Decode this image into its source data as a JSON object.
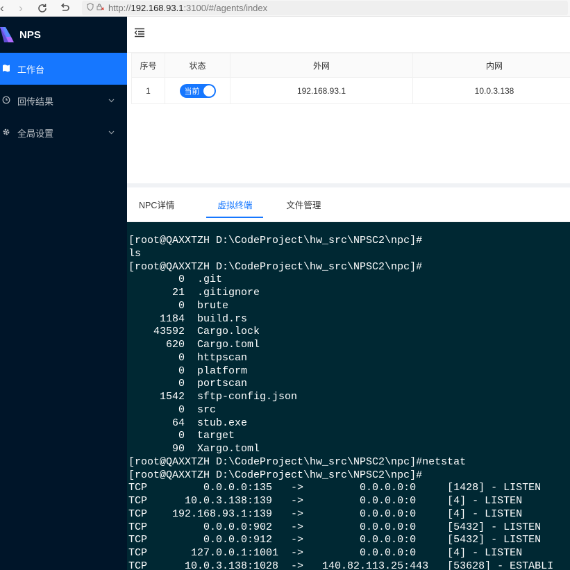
{
  "browser": {
    "url_prefix": "http://",
    "url_host": "192.168.93.1",
    "url_rest": ":3100/#/agents/index"
  },
  "sidebar": {
    "logo_text": "NPS",
    "items": [
      {
        "label": "工作台"
      },
      {
        "label": "回传结果"
      },
      {
        "label": "全局设置"
      }
    ]
  },
  "table": {
    "headers": [
      "序号",
      "状态",
      "外网",
      "内网"
    ],
    "rows": [
      {
        "index": "1",
        "status_label": "当前",
        "status_on": true,
        "external": "192.168.93.1",
        "internal": "10.0.3.138"
      }
    ]
  },
  "tabs": [
    {
      "label": "NPC详情",
      "active": false
    },
    {
      "label": "虚拟终端",
      "active": true
    },
    {
      "label": "文件管理",
      "active": false
    }
  ],
  "terminal": {
    "lines": [
      "[root@QAXXTZH D:\\CodeProject\\hw_src\\NPSC2\\npc]#",
      "ls",
      "[root@QAXXTZH D:\\CodeProject\\hw_src\\NPSC2\\npc]#",
      "        0  .git",
      "       21  .gitignore",
      "        0  brute",
      "     1184  build.rs",
      "    43592  Cargo.lock",
      "      620  Cargo.toml",
      "        0  httpscan",
      "        0  platform",
      "        0  portscan",
      "     1542  sftp-config.json",
      "        0  src",
      "       64  stub.exe",
      "        0  target",
      "       90  Xargo.toml",
      "[root@QAXXTZH D:\\CodeProject\\hw_src\\NPSC2\\npc]#netstat",
      "[root@QAXXTZH D:\\CodeProject\\hw_src\\NPSC2\\npc]#",
      "TCP         0.0.0.0:135   ->         0.0.0.0:0     [1428] - LISTEN",
      "TCP      10.0.3.138:139   ->         0.0.0.0:0     [4] - LISTEN",
      "TCP    192.168.93.1:139   ->         0.0.0.0:0     [4] - LISTEN",
      "TCP         0.0.0.0:902   ->         0.0.0.0:0     [5432] - LISTEN",
      "TCP         0.0.0.0:912   ->         0.0.0.0:0     [5432] - LISTEN",
      "TCP       127.0.0.1:1001  ->         0.0.0.0:0     [4] - LISTEN",
      "TCP      10.0.3.138:1028  ->   140.82.113.25:443   [53628] - ESTABLI"
    ]
  },
  "colors": {
    "sidebar_bg": "#001529",
    "accent": "#1677ff",
    "terminal_bg": "#002833"
  }
}
